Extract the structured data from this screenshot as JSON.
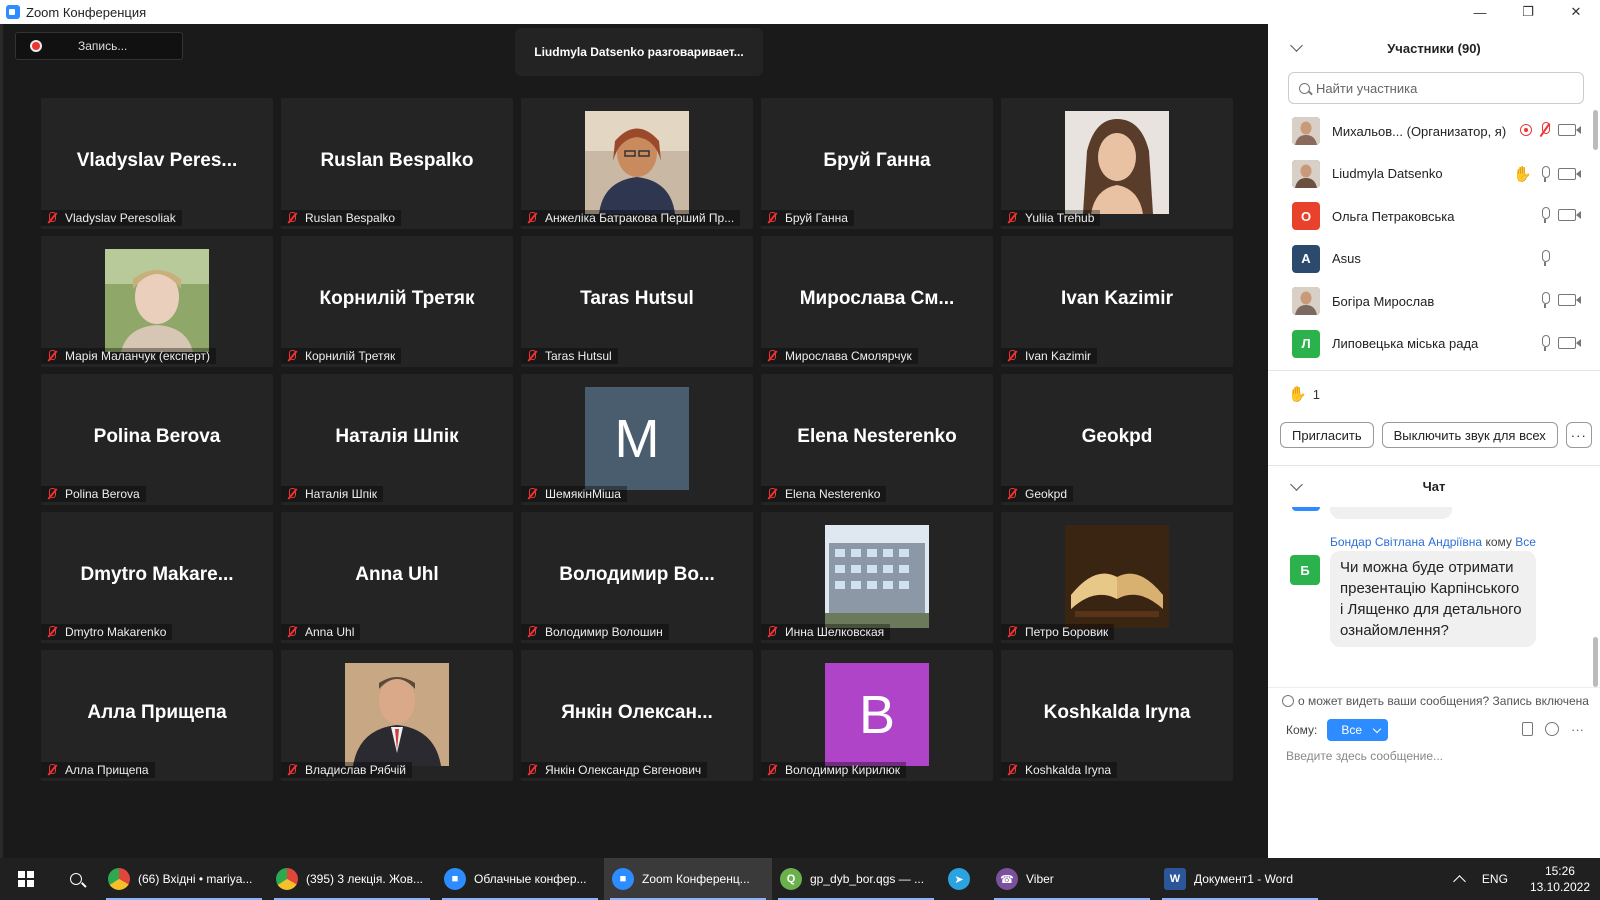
{
  "window": {
    "title": "Zoom Конференция"
  },
  "video": {
    "record_label": "Запись...",
    "speaking": "Liudmyla Datsenko разговаривает...",
    "tiles": [
      {
        "big": "Vladyslav  Peres...",
        "label": "Vladyslav Peresoliak",
        "type": "name"
      },
      {
        "big": "Ruslan Bespalko",
        "label": "Ruslan Bespalko",
        "type": "name"
      },
      {
        "big": "",
        "label": "Анжеліка Батракова Перший Пр...",
        "type": "photo",
        "photo": "woman-glasses"
      },
      {
        "big": "Бруй Ганна",
        "label": "Бруй Ганна",
        "type": "name"
      },
      {
        "big": "",
        "label": "Yuliia Trehub",
        "type": "photo",
        "photo": "woman-portrait"
      },
      {
        "big": "",
        "label": "Марія Маланчук (експерт)",
        "type": "photo",
        "photo": "woman-outdoor"
      },
      {
        "big": "Корнилій Третяк",
        "label": "Корнилій Третяк",
        "type": "name"
      },
      {
        "big": "Taras Hutsul",
        "label": "Taras Hutsul",
        "type": "name"
      },
      {
        "big": "Мирослава  См...",
        "label": "Мирослава Смолярчук",
        "type": "name"
      },
      {
        "big": "Ivan Kazimir",
        "label": "Ivan Kazimir",
        "type": "name"
      },
      {
        "big": "Polina Berova",
        "label": "Polina Berova",
        "type": "name"
      },
      {
        "big": "Наталія Шпік",
        "label": "Наталія Шпік",
        "type": "name"
      },
      {
        "big": "M",
        "label": "ШемякінМіша",
        "type": "letter",
        "color": "#4a5d6e"
      },
      {
        "big": "Elena Nesterenko",
        "label": "Elena Nesterenko",
        "type": "name"
      },
      {
        "big": "Geokpd",
        "label": "Geokpd",
        "type": "name"
      },
      {
        "big": "Dmytro  Makare...",
        "label": "Dmytro Makarenko",
        "type": "name"
      },
      {
        "big": "Anna Uhl",
        "label": "Anna Uhl",
        "type": "name"
      },
      {
        "big": "Володимир  Во...",
        "label": "Володимир Волошин",
        "type": "name"
      },
      {
        "big": "",
        "label": "Инна Шелковская",
        "type": "photo",
        "photo": "building"
      },
      {
        "big": "",
        "label": "Петро Боровик",
        "type": "photo",
        "photo": "book"
      },
      {
        "big": "Алла Прищепа",
        "label": "Алла Прищепа",
        "type": "name"
      },
      {
        "big": "",
        "label": "Владислав Рябчій",
        "type": "photo",
        "photo": "man-suit"
      },
      {
        "big": "Янкін  Олексан...",
        "label": "Янкін Олександр Євгенович",
        "type": "name"
      },
      {
        "big": "B",
        "label": "Володимир Кирилюк",
        "type": "letter",
        "color": "#b044c8"
      },
      {
        "big": "Koshkalda Iryna",
        "label": "Koshkalda Iryna",
        "type": "name"
      }
    ]
  },
  "participants": {
    "title": "Участники (90)",
    "search_placeholder": "Найти участника",
    "list": [
      {
        "name": "Михальов...  (Организатор, я)",
        "avatar": "photo",
        "color": "#8a6a5a",
        "letter": "",
        "rec": true,
        "hand": false,
        "mic": "off",
        "cam": true
      },
      {
        "name": "Liudmyla Datsenko",
        "avatar": "photo",
        "color": "#6a5040",
        "letter": "",
        "rec": false,
        "hand": true,
        "mic": "on",
        "cam": true
      },
      {
        "name": "Ольга Петраковська",
        "avatar": "letter",
        "color": "#e8412c",
        "letter": "О",
        "rec": false,
        "hand": false,
        "mic": "on",
        "cam": true
      },
      {
        "name": "Asus",
        "avatar": "letter",
        "color": "#2c4a6e",
        "letter": "A",
        "rec": false,
        "hand": false,
        "mic": "on",
        "cam": false
      },
      {
        "name": "Богіра Мирослав",
        "avatar": "photo",
        "color": "#7a6a60",
        "letter": "",
        "rec": false,
        "hand": false,
        "mic": "on",
        "cam": true
      },
      {
        "name": "Липовецька міська рада",
        "avatar": "letter",
        "color": "#2bb24c",
        "letter": "Л",
        "rec": false,
        "hand": false,
        "mic": "on",
        "cam": true
      }
    ],
    "raised_count": "1",
    "invite_label": "Пригласить",
    "mute_all_label": "Выключить звук для всех",
    "more_label": "···"
  },
  "chat": {
    "title": "Чат",
    "sender": "Бондар Світлана Андріївна",
    "to_word": "кому",
    "to_target": "Все",
    "avatar_letter": "Б",
    "message": "Чи можна буде отримати презентацію Карпінського і Лященко для детального ознайомлення?",
    "notice": "о может видеть ваши сообщения? Запись включена",
    "to_label": "Кому:",
    "to_value": "Все",
    "input_placeholder": "Введите здесь сообщение..."
  },
  "taskbar": {
    "items": [
      {
        "label": "(66) Вхідні • mariya...",
        "icon": "chrome",
        "color": "#e0463a",
        "running": true,
        "active": false
      },
      {
        "label": "(395) 3 лекція. Жов...",
        "icon": "chrome",
        "color": "#e0463a",
        "running": true,
        "active": false
      },
      {
        "label": "Облачные конфер...",
        "icon": "zoom",
        "color": "#2d8cff",
        "running": true,
        "active": false
      },
      {
        "label": "Zoom Конференц...",
        "icon": "zoom",
        "color": "#2d8cff",
        "running": true,
        "active": true
      },
      {
        "label": "gp_dyb_bor.qgs — ...",
        "icon": "qgis",
        "color": "#6ab04c",
        "running": true,
        "active": false
      },
      {
        "label": "",
        "icon": "telegram",
        "color": "#2aa3e0",
        "running": false,
        "active": false
      },
      {
        "label": "Viber",
        "icon": "viber",
        "color": "#7b519d",
        "running": true,
        "active": false
      },
      {
        "label": "Документ1 - Word",
        "icon": "word",
        "color": "#2b579a",
        "running": true,
        "active": false
      }
    ],
    "lang": "ENG",
    "time": "15:26",
    "date": "13.10.2022"
  }
}
